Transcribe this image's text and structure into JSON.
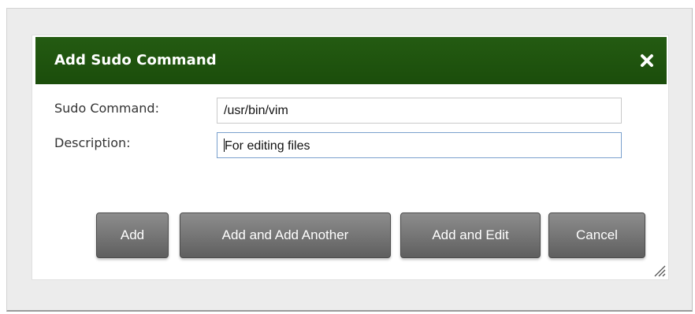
{
  "dialog": {
    "title": "Add Sudo Command",
    "close_icon": "close-icon"
  },
  "form": {
    "sudo_command": {
      "label": "Sudo Command:",
      "value": "/usr/bin/vim"
    },
    "description": {
      "label": "Description:",
      "value": "For editing files"
    }
  },
  "buttons": {
    "add": "Add",
    "add_and_add_another": "Add and Add Another",
    "add_and_edit": "Add and Edit",
    "cancel": "Cancel"
  },
  "colors": {
    "titlebar": "#1f5410",
    "button": "#6e6e6e",
    "input_focus_border": "#7aa0cd"
  }
}
